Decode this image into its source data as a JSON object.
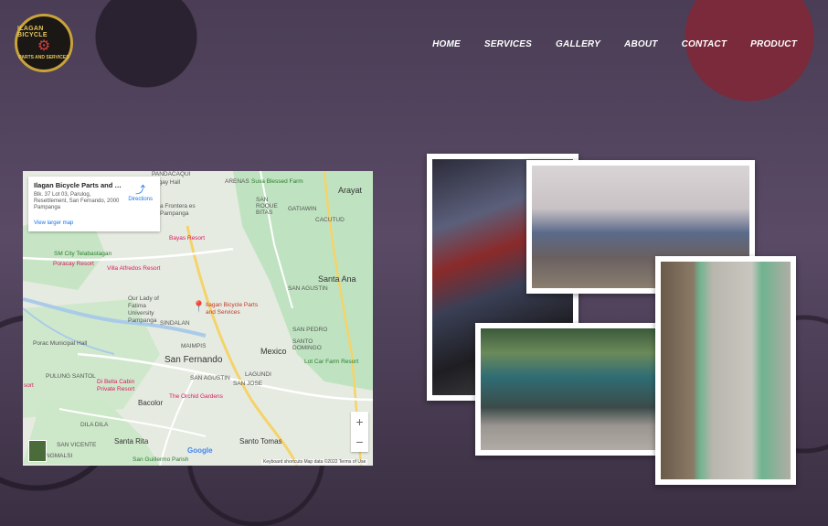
{
  "logo": {
    "title": "ILAGAN BICYCLE",
    "subtitle": "PARTS AND SERVICES"
  },
  "nav": [
    "HOME",
    "SERVICES",
    "GALLERY",
    "ABOUT",
    "CONTACT",
    "PRODUCT"
  ],
  "map": {
    "place_name": "Ilagan Bicycle Parts and Servi...",
    "address": "Blk. 37 Lot 03, Parulog, Resettlement, San Fernando, 2000 Pampanga",
    "view_larger": "View larger map",
    "directions": "Directions",
    "pin_label": "Ilagan Bicycle Parts and Services",
    "labels": {
      "pandacaqui": "PANDACAQUI",
      "pangay": "ngay Hall",
      "suva": "Suva Blessed Farm",
      "arayat": "Arayat",
      "arenas": "ARENAS",
      "san_roque": "SAN ROQUE BITAS",
      "gatiawin": "GATIAWIN",
      "cacutud": "CACUTUD",
      "la_frontera": "a Frontera es Pampanga",
      "bayas": "Bayas Resort",
      "sm_city": "SM City Telabastagan",
      "poracay": "Poracay Resort",
      "villa": "Villa Alfredos  Resort",
      "santa_ana": "Santa Ana",
      "san_agustin1": "SAN AGUSTIN",
      "our_lady": "Our Lady of Fatima University Pampanga",
      "sindalan": "SINDALAN",
      "san_pedro": "SAN PEDRO",
      "porac": "Porac Municipal Hall",
      "maimpis": "MAIMPIS",
      "mexico": "Mexico",
      "santo_domingo": "SANTO DOMINGO",
      "san_fernando": "San Fernando",
      "lot_car": "Lot Car Farm Resort",
      "pulung_santol": "PULUNG SANTOL",
      "san_agustin2": "SAN AGUSTIN",
      "san_jose": "SAN JOSE",
      "lagundi": "LAGUNDI",
      "di_bella": "Di Bella Cabin Private Resort",
      "orchid": "The Orchid Gardens",
      "bacolor": "Bacolor",
      "dila_dila": "DILA DILA",
      "santa_rita": "Santa Rita",
      "santo_tomas": "Santo Tomas",
      "san_vicente": "SAN VICENTE",
      "ngmalsi": "NGMALSI",
      "san_guillermo": "San Guillermo Parish",
      "resort": "sort"
    },
    "zoom_in": "+",
    "zoom_out": "−",
    "google": "Google",
    "footer": "Keyboard shortcuts   Map data ©2022   Terms of Use"
  },
  "icons": {
    "directions": "directions-icon",
    "pin": "map-pin-icon"
  }
}
